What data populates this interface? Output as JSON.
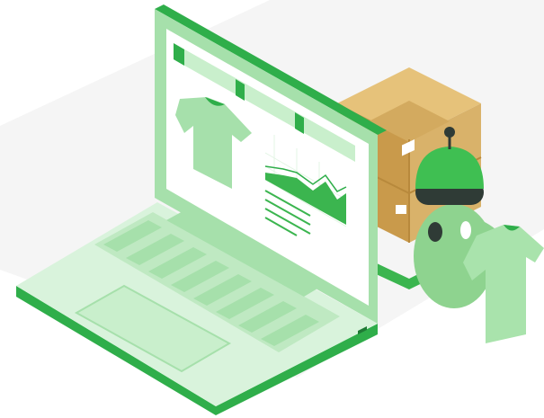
{
  "illustration": {
    "subject": "",
    "colors": {
      "background_panel": "#f4f4f4",
      "laptop_light": "#d9f3dc",
      "laptop_mid": "#a6e0ab",
      "laptop_dark": "#2fae4a",
      "screen_bg": "#ffffff",
      "accent_green": "#3bb54f",
      "box_tan": "#d9b26a",
      "box_shadow": "#b58d44",
      "robot_body": "#8ed38f",
      "robot_dome": "#3fbf52",
      "robot_band": "#2f3b36",
      "shirt": "#a9e3ac"
    },
    "icons": [
      "tshirt-icon",
      "area-chart-icon",
      "robot-icon",
      "cardboard-box-icon"
    ]
  }
}
